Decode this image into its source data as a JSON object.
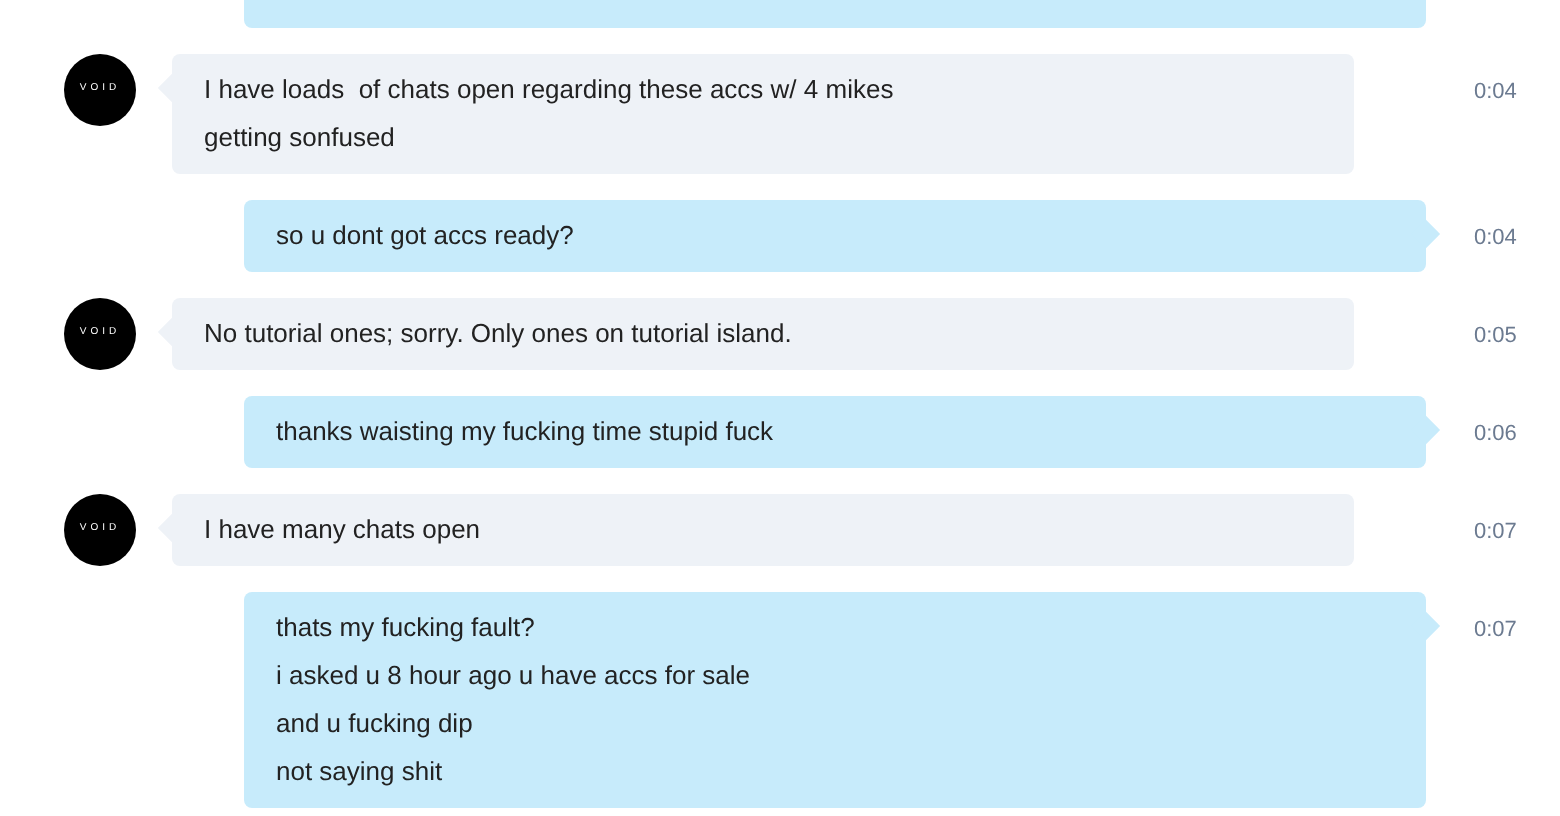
{
  "messages": [
    {
      "kind": "sent",
      "cut": true
    },
    {
      "kind": "received",
      "avatar": "VOID",
      "lines": [
        "I have loads  of chats open regarding these accs w/ 4 mikes",
        "getting sonfused"
      ],
      "time": "0:04"
    },
    {
      "kind": "sent",
      "lines": [
        "so u dont got accs ready?"
      ],
      "time": "0:04"
    },
    {
      "kind": "received",
      "avatar": "VOID",
      "lines": [
        "No tutorial ones; sorry. Only ones on tutorial island."
      ],
      "time": "0:05"
    },
    {
      "kind": "sent",
      "lines": [
        "thanks waisting my fucking time stupid fuck"
      ],
      "time": "0:06"
    },
    {
      "kind": "received",
      "avatar": "VOID",
      "lines": [
        "I have many chats open"
      ],
      "time": "0:07"
    },
    {
      "kind": "sent",
      "lines": [
        "thats my fucking fault?",
        "i asked u 8 hour ago u have accs for sale",
        "and u fucking dip",
        "not saying shit"
      ],
      "time": "0:07"
    }
  ]
}
